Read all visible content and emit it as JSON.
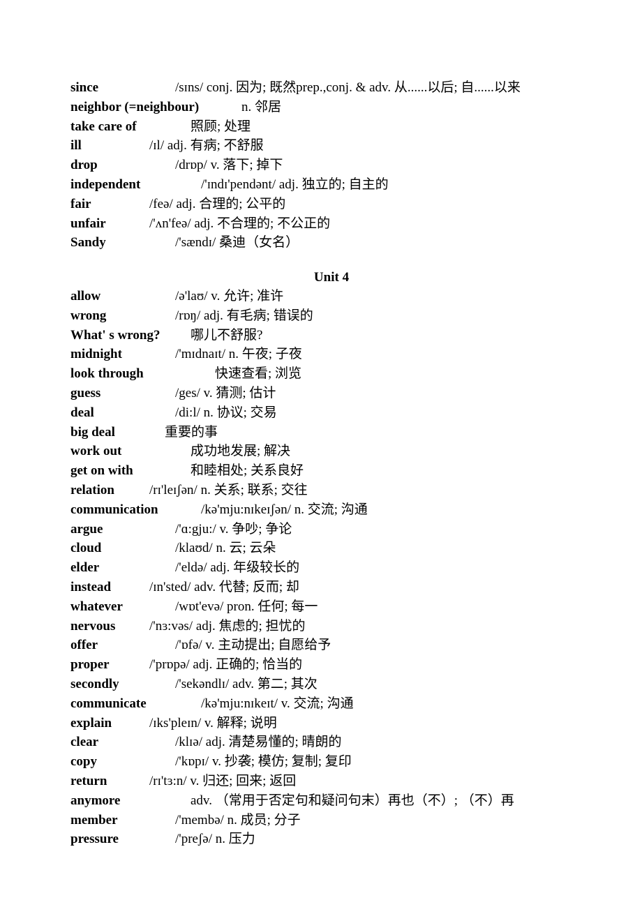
{
  "document": {
    "section1": [
      {
        "word": "since",
        "rest": "/sɪns/    conj.  因为;  既然prep.,conj. & adv.  从......以后;  自......以来",
        "col": 150
      },
      {
        "word": "neighbor (=neighbour)",
        "rest": "n.  邻居",
        "col": 245
      },
      {
        "word": "take care of",
        "rest": "照顾;  处理",
        "col": 172
      },
      {
        "word": "ill",
        "rest": "/ɪl/    adj.  有病;  不舒服",
        "col": 113
      },
      {
        "word": "drop",
        "rest": "/drɒp/    v.  落下;  掉下",
        "col": 150
      },
      {
        "word": "independent",
        "rest": "/'ɪndɪ'pendənt/    adj.  独立的;  自主的",
        "col": 187
      },
      {
        "word": "fair",
        "rest": "/feə/    adj.  合理的;  公平的",
        "col": 113
      },
      {
        "word": "unfair",
        "rest": "/'ʌn'feə/    adj.  不合理的;  不公正的",
        "col": 113
      },
      {
        "word": "Sandy",
        "rest": "/'sændɪ/    桑迪（女名）",
        "col": 150
      }
    ],
    "unit_title": "Unit 4",
    "section2": [
      {
        "word": "allow",
        "rest": "/ə'laʊ/    v.  允许;  准许",
        "col": 150
      },
      {
        "word": "wrong",
        "rest": "/rɒŋ/    adj.  有毛病;  错误的",
        "col": 150
      },
      {
        "word": "What' s wrong?",
        "rest": "哪儿不舒服?",
        "col": 172
      },
      {
        "word": "midnight",
        "rest": "/'mɪdnaɪt/    n.  午夜;  子夜",
        "col": 150
      },
      {
        "word": "look through",
        "rest": "快速查看;    浏览",
        "col": 207
      },
      {
        "word": "guess",
        "rest": "/ges/    v.  猜测;  估计",
        "col": 150
      },
      {
        "word": "deal",
        "rest": "/di:l/    n.  协议;  交易",
        "col": 150
      },
      {
        "word": "big deal",
        "rest": "重要的事",
        "col": 135
      },
      {
        "word": "work out",
        "rest": "成功地发展;  解决",
        "col": 172
      },
      {
        "word": "get on with",
        "rest": "和睦相处;  关系良好",
        "col": 172
      },
      {
        "word": "relation",
        "rest": "/rɪ'leɪʃən/    n.  关系;  联系;  交往",
        "col": 113
      },
      {
        "word": "communication",
        "rest": "/kə'mju:nɪkeɪʃən/    n.  交流;  沟通",
        "col": 187
      },
      {
        "word": "argue",
        "rest": "/'ɑ:gju:/    v.  争吵;  争论",
        "col": 150
      },
      {
        "word": "cloud",
        "rest": "/klaʊd/    n.  云;  云朵",
        "col": 150
      },
      {
        "word": "elder",
        "rest": "/'eldə/    adj.  年级较长的",
        "col": 150
      },
      {
        "word": "instead",
        "rest": "/ɪn'sted/    adv.  代替;  反而;  却",
        "col": 113
      },
      {
        "word": "whatever",
        "rest": "/wɒt'evə/    pron.  任何;  每一",
        "col": 150
      },
      {
        "word": "nervous",
        "rest": "/'nɜ:vəs/    adj.  焦虑的;  担忧的",
        "col": 113
      },
      {
        "word": "offer",
        "rest": "/'ɒfə/    v.  主动提出;  自愿给予",
        "col": 150
      },
      {
        "word": "proper",
        "rest": "/'prɒpə/    adj.  正确的;  恰当的",
        "col": 113
      },
      {
        "word": "secondly",
        "rest": "/'sekəndlɪ/    adv.  第二;  其次",
        "col": 150
      },
      {
        "word": "communicate",
        "rest": "/kə'mju:nɪkeɪt/    v.  交流;  沟通",
        "col": 187
      },
      {
        "word": "explain",
        "rest": "/ɪks'pleɪn/    v.  解释;  说明",
        "col": 113
      },
      {
        "word": "clear",
        "rest": "/klɪə/    adj.  清楚易懂的;  晴朗的",
        "col": 150
      },
      {
        "word": "copy",
        "rest": "/'kɒpɪ/    v.  抄袭;  模仿;  复制;  复印",
        "col": 150
      },
      {
        "word": "return",
        "rest": "/rɪ'tɜ:n/    v.  归还;  回来;  返回",
        "col": 113
      },
      {
        "word": "anymore",
        "rest": "adv.  （常用于否定句和疑问句末）再也（不）;  （不）再",
        "col": 172
      },
      {
        "word": "member",
        "rest": "/'membə/    n.  成员;  分子",
        "col": 150
      },
      {
        "word": "pressure",
        "rest": "/'preʃə/    n.  压力",
        "col": 150
      }
    ]
  }
}
